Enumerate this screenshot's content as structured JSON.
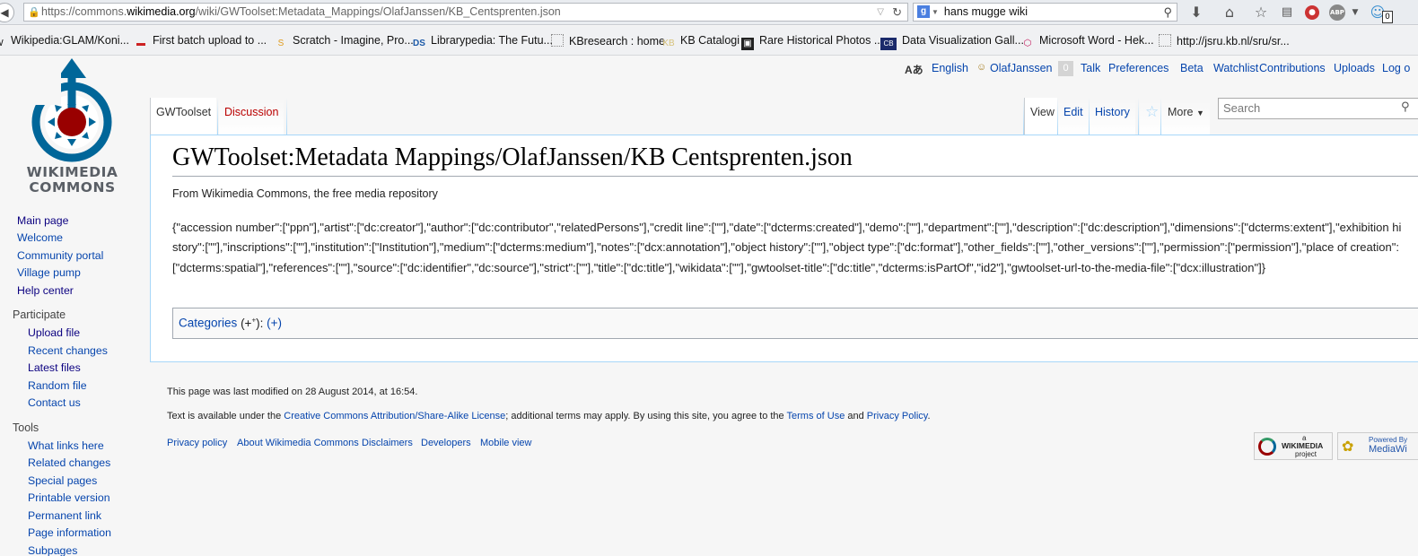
{
  "browser": {
    "url_prefix": "https://commons.",
    "url_domain": "wikimedia.org",
    "url_path": "/wiki/GWToolset:Metadata_Mappings/OlafJanssen/KB_Centsprenten.json",
    "search_value": "hans mugge wiki",
    "ghost_count": "0"
  },
  "bookmarks": [
    "Wikipedia:GLAM/Koni...",
    "First batch upload to ...",
    "Scratch - Imagine, Pro...",
    "Librarypedia: The Futu...",
    "KBresearch : home",
    "KB Catalogi",
    "Rare Historical Photos ...",
    "Data Visualization Gall...",
    "Microsoft Word - Hek...",
    "http://jsru.kb.nl/sru/sr..."
  ],
  "logo": {
    "line1": "WIKIMEDIA",
    "line2": "COMMONS"
  },
  "personal": {
    "language": "English",
    "username": "OlafJanssen",
    "notifications": "0",
    "talk": "Talk",
    "preferences": "Preferences",
    "beta": "Beta",
    "watchlist": "Watchlist",
    "contributions": "Contributions",
    "uploads": "Uploads",
    "logout": "Log o"
  },
  "tabs": {
    "namespace": "GWToolset",
    "discussion": "Discussion",
    "view": "View",
    "edit": "Edit",
    "history": "History",
    "more": "More",
    "search_placeholder": "Search"
  },
  "content": {
    "title": "GWToolset:Metadata Mappings/OlafJanssen/KB Centsprenten.json",
    "tagline": "From Wikimedia Commons, the free media repository",
    "json_text": "{\"accession number\":[\"ppn\"],\"artist\":[\"dc:creator\"],\"author\":[\"dc:contributor\",\"relatedPersons\"],\"credit line\":[\"\"],\"date\":[\"dcterms:created\"],\"demo\":[\"\"],\"department\":[\"\"],\"description\":[\"dc:description\"],\"dimensions\":[\"dcterms:extent\"],\"exhibition history\":[\"\"],\"inscriptions\":[\"\"],\"institution\":[\"Institution\"],\"medium\":[\"dcterms:medium\"],\"notes\":[\"dcx:annotation\"],\"object history\":[\"\"],\"object type\":[\"dc:format\"],\"other_fields\":[\"\"],\"other_versions\":[\"\"],\"permission\":[\"permission\"],\"place of creation\":[\"dcterms:spatial\"],\"references\":[\"\"],\"source\":[\"dc:identifier\",\"dc:source\"],\"strict\":[\"\"],\"title\":[\"dc:title\"],\"wikidata\":[\"\"],\"gwtoolset-title\":[\"dc:title\",\"dcterms:isPartOf\",\"id2\"],\"gwtoolset-url-to-the-media-file\":[\"dcx:illustration\"]}",
    "categories_label": "Categories",
    "cat_plus": "(+",
    "cat_sup": "+",
    "cat_close": "):",
    "cat_add": "(+)"
  },
  "sidebar": {
    "main_page": "Main page",
    "welcome": "Welcome",
    "community_portal": "Community portal",
    "village_pump": "Village pump",
    "help_center": "Help center",
    "participate": "Participate",
    "upload_file": "Upload file",
    "recent_changes": "Recent changes",
    "latest_files": "Latest files",
    "random_file": "Random file",
    "contact_us": "Contact us",
    "tools": "Tools",
    "what_links_here": "What links here",
    "related_changes": "Related changes",
    "special_pages": "Special pages",
    "printable_version": "Printable version",
    "permanent_link": "Permanent link",
    "page_information": "Page information",
    "subpages": "Subpages"
  },
  "footer": {
    "last_modified": "This page was last modified on 28 August 2014, at 16:54.",
    "license_pre": "Text is available under the ",
    "license_link": "Creative Commons Attribution/Share-Alike License",
    "license_mid": "; additional terms may apply. By using this site, you agree to the ",
    "terms_link": "Terms of Use",
    "and": " and ",
    "privacy_link": "Privacy Policy",
    "dot": ".",
    "links": [
      "Privacy policy",
      "About Wikimedia Commons",
      "Disclaimers",
      "Developers",
      "Mobile view"
    ],
    "wm_badge_small": "a",
    "wm_badge_big": "WIKIMEDIA",
    "wm_badge_sub": "project",
    "mw_badge_small": "Powered By",
    "mw_badge_big": "MediaWi"
  }
}
